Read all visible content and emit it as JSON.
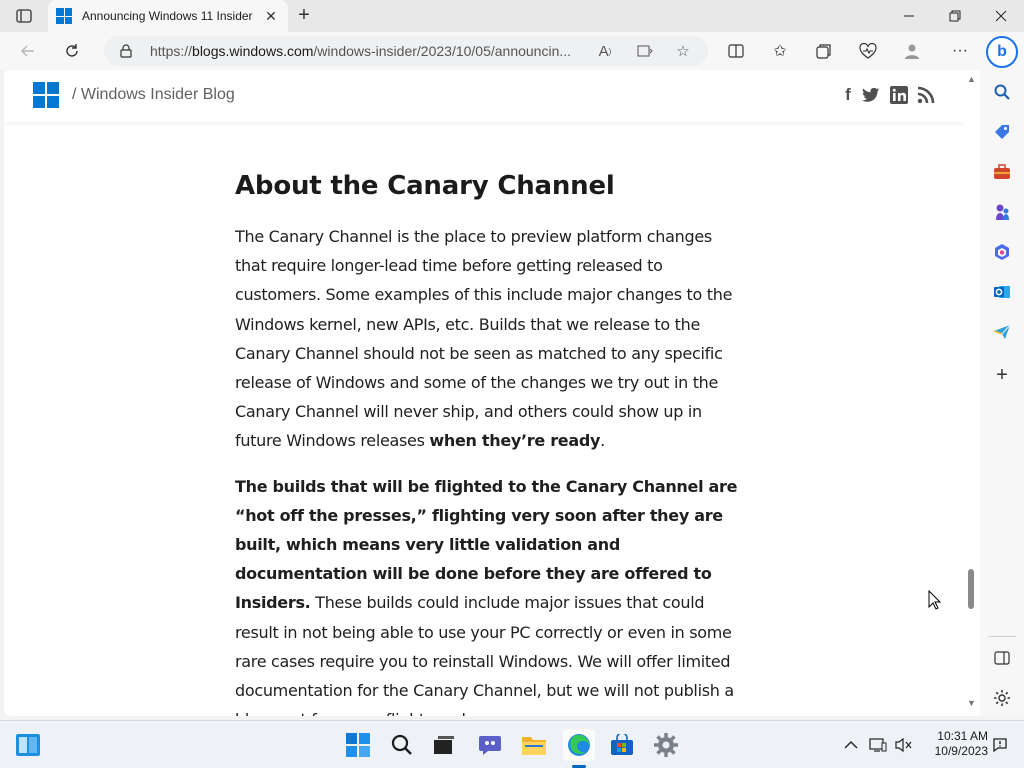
{
  "browser": {
    "tab_title": "Announcing Windows 11 Insider",
    "url_prefix": "https://",
    "url_host": "blogs.windows.com",
    "url_path": "/windows-insider/2023/10/05/announcin..."
  },
  "site": {
    "breadcrumb": "/ Windows Insider Blog",
    "social": [
      {
        "name": "facebook-icon",
        "glyph": "f"
      },
      {
        "name": "twitter-icon",
        "glyph": "t"
      },
      {
        "name": "linkedin-icon",
        "glyph": "in"
      },
      {
        "name": "rss-icon",
        "glyph": "rss"
      }
    ]
  },
  "article": {
    "heading": "About the Canary Channel",
    "p1_text": "The Canary Channel is the place to preview platform changes that require longer-lead time before getting released to customers. Some examples of this include major changes to the Windows kernel, new APIs, etc. Builds that we release to the Canary Channel should not be seen as matched to any specific release of Windows and some of the changes we try out in the Canary Channel will never ship, and others could show up in future Windows releases ",
    "p1_bold": "when they’re ready",
    "p1_end": ".",
    "p2_bold": "The builds that will be flighted to the Canary Channel are “hot off the presses,” flighting very soon after they are built, which means very little validation and documentation will be done before they are offered to Insiders.",
    "p2_text": " These builds could include major issues that could result in not being able to use your PC correctly or even in some rare cases require you to reinstall Windows. We will offer limited documentation for the Canary Channel, but we will not publish a blog post for every flight – only"
  },
  "taskbar": {
    "time": "10:31 AM",
    "date": "10/9/2023"
  },
  "colors": {
    "accent": "#0078d4",
    "copilot": "#1a73e8"
  }
}
